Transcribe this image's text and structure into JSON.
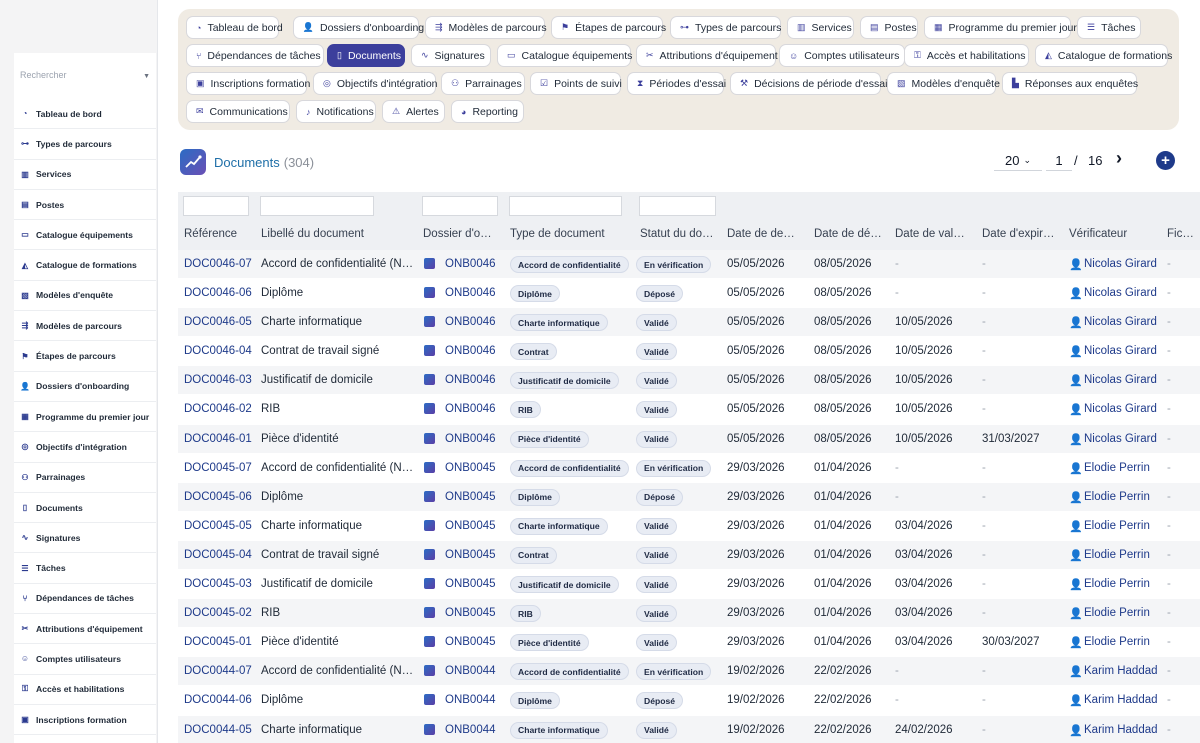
{
  "sidebar": {
    "search_placeholder": "Rechercher",
    "items": [
      {
        "label": "Tableau de bord",
        "icon": "dashboard-icon"
      },
      {
        "label": "Types de parcours",
        "icon": "sitemap-icon"
      },
      {
        "label": "Services",
        "icon": "building-icon"
      },
      {
        "label": "Postes",
        "icon": "id-card-icon"
      },
      {
        "label": "Catalogue équipements",
        "icon": "laptop-icon"
      },
      {
        "label": "Catalogue de formations",
        "icon": "graduation-cap-icon"
      },
      {
        "label": "Modèles d'enquête",
        "icon": "clipboard-icon"
      },
      {
        "label": "Modèles de parcours",
        "icon": "signpost-icon"
      },
      {
        "label": "Étapes de parcours",
        "icon": "flag-icon"
      },
      {
        "label": "Dossiers d'onboarding",
        "icon": "user-plus-icon"
      },
      {
        "label": "Programme du premier jour",
        "icon": "calendar-icon"
      },
      {
        "label": "Objectifs d'intégration",
        "icon": "target-icon"
      },
      {
        "label": "Parrainages",
        "icon": "users-icon"
      },
      {
        "label": "Documents",
        "icon": "document-icon"
      },
      {
        "label": "Signatures",
        "icon": "signature-icon"
      },
      {
        "label": "Tâches",
        "icon": "list-icon"
      },
      {
        "label": "Dépendances de tâches",
        "icon": "branch-icon"
      },
      {
        "label": "Attributions d'équipement",
        "icon": "tools-icon"
      },
      {
        "label": "Comptes utilisateurs",
        "icon": "user-cog-icon"
      },
      {
        "label": "Accès et habilitations",
        "icon": "key-icon"
      },
      {
        "label": "Inscriptions formation",
        "icon": "register-icon"
      }
    ]
  },
  "nav": {
    "items": [
      {
        "label": "Tableau de bord",
        "icon": "dashboard-icon"
      },
      {
        "label": "Dossiers d'onboarding",
        "icon": "user-plus-icon"
      },
      {
        "label": "Modèles de parcours",
        "icon": "signpost-icon"
      },
      {
        "label": "Étapes de parcours",
        "icon": "flag-icon"
      },
      {
        "label": "Types de parcours",
        "icon": "sitemap-icon"
      },
      {
        "label": "Services",
        "icon": "building-icon"
      },
      {
        "label": "Postes",
        "icon": "id-card-icon"
      },
      {
        "label": "Programme du premier jour",
        "icon": "calendar-icon"
      },
      {
        "label": "Tâches",
        "icon": "list-icon"
      },
      {
        "label": "Dépendances de tâches",
        "icon": "branch-icon"
      },
      {
        "label": "Documents",
        "icon": "document-icon",
        "active": true
      },
      {
        "label": "Signatures",
        "icon": "signature-icon"
      },
      {
        "label": "Catalogue équipements",
        "icon": "laptop-icon"
      },
      {
        "label": "Attributions d'équipement",
        "icon": "tools-icon"
      },
      {
        "label": "Comptes utilisateurs",
        "icon": "user-cog-icon"
      },
      {
        "label": "Accès et habilitations",
        "icon": "key-icon"
      },
      {
        "label": "Catalogue de formations",
        "icon": "graduation-cap-icon"
      },
      {
        "label": "Inscriptions formation",
        "icon": "register-icon"
      },
      {
        "label": "Objectifs d'intégration",
        "icon": "target-icon"
      },
      {
        "label": "Parrainages",
        "icon": "users-icon"
      },
      {
        "label": "Points de suivi",
        "icon": "checkpoint-icon"
      },
      {
        "label": "Périodes d'essai",
        "icon": "hourglass-icon"
      },
      {
        "label": "Décisions de période d'essai",
        "icon": "gavel-icon"
      },
      {
        "label": "Modèles d'enquête",
        "icon": "clipboard-icon"
      },
      {
        "label": "Réponses aux enquêtes",
        "icon": "bar-chart-icon"
      },
      {
        "label": "Communications",
        "icon": "envelope-icon"
      },
      {
        "label": "Notifications",
        "icon": "bell-icon"
      },
      {
        "label": "Alertes",
        "icon": "warning-icon"
      },
      {
        "label": "Reporting",
        "icon": "pie-chart-icon"
      }
    ]
  },
  "header": {
    "title": "Documents",
    "count": "(304)",
    "page_size": "20",
    "page": "1",
    "page_sep": "/",
    "total_pages": "16"
  },
  "table": {
    "columns": [
      "Référence",
      "Libellé du document",
      "Dossier d'onboarding",
      "Type de document",
      "Statut du document",
      "Date de demande",
      "Date de dépôt",
      "Date de validation",
      "Date d'expiration",
      "Vérificateur",
      "Fichier"
    ],
    "rows": [
      {
        "ref": "DOC0046-07",
        "label": "Accord de confidentialité (NDA)",
        "dossier": "ONB0046",
        "type": "Accord de confidentialité",
        "status": "En vérification",
        "d_req": "05/05/2026",
        "d_dep": "08/05/2026",
        "d_val": "-",
        "d_exp": "-",
        "verif": "Nicolas Girard",
        "file": "-"
      },
      {
        "ref": "DOC0046-06",
        "label": "Diplôme",
        "dossier": "ONB0046",
        "type": "Diplôme",
        "status": "Déposé",
        "d_req": "05/05/2026",
        "d_dep": "08/05/2026",
        "d_val": "-",
        "d_exp": "-",
        "verif": "Nicolas Girard",
        "file": "-"
      },
      {
        "ref": "DOC0046-05",
        "label": "Charte informatique",
        "dossier": "ONB0046",
        "type": "Charte informatique",
        "status": "Validé",
        "d_req": "05/05/2026",
        "d_dep": "08/05/2026",
        "d_val": "10/05/2026",
        "d_exp": "-",
        "verif": "Nicolas Girard",
        "file": "-"
      },
      {
        "ref": "DOC0046-04",
        "label": "Contrat de travail signé",
        "dossier": "ONB0046",
        "type": "Contrat",
        "status": "Validé",
        "d_req": "05/05/2026",
        "d_dep": "08/05/2026",
        "d_val": "10/05/2026",
        "d_exp": "-",
        "verif": "Nicolas Girard",
        "file": "-"
      },
      {
        "ref": "DOC0046-03",
        "label": "Justificatif de domicile",
        "dossier": "ONB0046",
        "type": "Justificatif de domicile",
        "status": "Validé",
        "d_req": "05/05/2026",
        "d_dep": "08/05/2026",
        "d_val": "10/05/2026",
        "d_exp": "-",
        "verif": "Nicolas Girard",
        "file": "-"
      },
      {
        "ref": "DOC0046-02",
        "label": "RIB",
        "dossier": "ONB0046",
        "type": "RIB",
        "status": "Validé",
        "d_req": "05/05/2026",
        "d_dep": "08/05/2026",
        "d_val": "10/05/2026",
        "d_exp": "-",
        "verif": "Nicolas Girard",
        "file": "-"
      },
      {
        "ref": "DOC0046-01",
        "label": "Pièce d'identité",
        "dossier": "ONB0046",
        "type": "Pièce d'identité",
        "status": "Validé",
        "d_req": "05/05/2026",
        "d_dep": "08/05/2026",
        "d_val": "10/05/2026",
        "d_exp": "31/03/2027",
        "verif": "Nicolas Girard",
        "file": "-"
      },
      {
        "ref": "DOC0045-07",
        "label": "Accord de confidentialité (NDA)",
        "dossier": "ONB0045",
        "type": "Accord de confidentialité",
        "status": "En vérification",
        "d_req": "29/03/2026",
        "d_dep": "01/04/2026",
        "d_val": "-",
        "d_exp": "-",
        "verif": "Elodie Perrin",
        "file": "-"
      },
      {
        "ref": "DOC0045-06",
        "label": "Diplôme",
        "dossier": "ONB0045",
        "type": "Diplôme",
        "status": "Déposé",
        "d_req": "29/03/2026",
        "d_dep": "01/04/2026",
        "d_val": "-",
        "d_exp": "-",
        "verif": "Elodie Perrin",
        "file": "-"
      },
      {
        "ref": "DOC0045-05",
        "label": "Charte informatique",
        "dossier": "ONB0045",
        "type": "Charte informatique",
        "status": "Validé",
        "d_req": "29/03/2026",
        "d_dep": "01/04/2026",
        "d_val": "03/04/2026",
        "d_exp": "-",
        "verif": "Elodie Perrin",
        "file": "-"
      },
      {
        "ref": "DOC0045-04",
        "label": "Contrat de travail signé",
        "dossier": "ONB0045",
        "type": "Contrat",
        "status": "Validé",
        "d_req": "29/03/2026",
        "d_dep": "01/04/2026",
        "d_val": "03/04/2026",
        "d_exp": "-",
        "verif": "Elodie Perrin",
        "file": "-"
      },
      {
        "ref": "DOC0045-03",
        "label": "Justificatif de domicile",
        "dossier": "ONB0045",
        "type": "Justificatif de domicile",
        "status": "Validé",
        "d_req": "29/03/2026",
        "d_dep": "01/04/2026",
        "d_val": "03/04/2026",
        "d_exp": "-",
        "verif": "Elodie Perrin",
        "file": "-"
      },
      {
        "ref": "DOC0045-02",
        "label": "RIB",
        "dossier": "ONB0045",
        "type": "RIB",
        "status": "Validé",
        "d_req": "29/03/2026",
        "d_dep": "01/04/2026",
        "d_val": "03/04/2026",
        "d_exp": "-",
        "verif": "Elodie Perrin",
        "file": "-"
      },
      {
        "ref": "DOC0045-01",
        "label": "Pièce d'identité",
        "dossier": "ONB0045",
        "type": "Pièce d'identité",
        "status": "Validé",
        "d_req": "29/03/2026",
        "d_dep": "01/04/2026",
        "d_val": "03/04/2026",
        "d_exp": "30/03/2027",
        "verif": "Elodie Perrin",
        "file": "-"
      },
      {
        "ref": "DOC0044-07",
        "label": "Accord de confidentialité (NDA)",
        "dossier": "ONB0044",
        "type": "Accord de confidentialité",
        "status": "En vérification",
        "d_req": "19/02/2026",
        "d_dep": "22/02/2026",
        "d_val": "-",
        "d_exp": "-",
        "verif": "Karim Haddad",
        "file": "-"
      },
      {
        "ref": "DOC0044-06",
        "label": "Diplôme",
        "dossier": "ONB0044",
        "type": "Diplôme",
        "status": "Déposé",
        "d_req": "19/02/2026",
        "d_dep": "22/02/2026",
        "d_val": "-",
        "d_exp": "-",
        "verif": "Karim Haddad",
        "file": "-"
      },
      {
        "ref": "DOC0044-05",
        "label": "Charte informatique",
        "dossier": "ONB0044",
        "type": "Charte informatique",
        "status": "Validé",
        "d_req": "19/02/2026",
        "d_dep": "22/02/2026",
        "d_val": "24/02/2026",
        "d_exp": "-",
        "verif": "Karim Haddad",
        "file": "-"
      }
    ]
  },
  "colors": {
    "accent": "#3c3f9c",
    "link": "#1e3a8a",
    "nav_bg": "#f0ebe3",
    "title": "#1f6fa8"
  }
}
